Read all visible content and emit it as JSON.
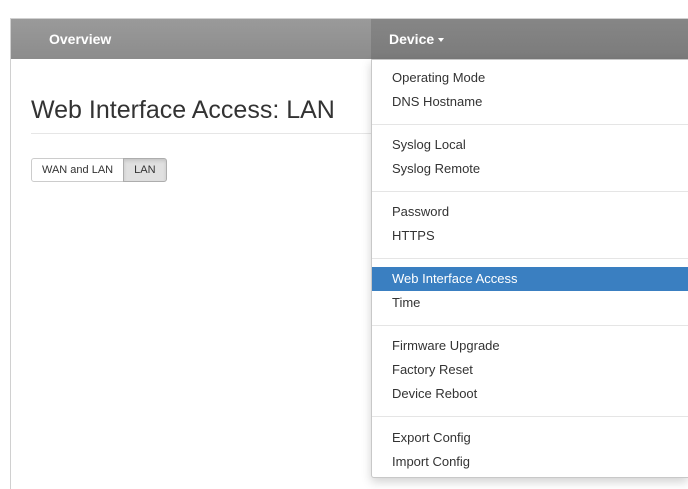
{
  "navbar": {
    "overview_label": "Overview",
    "device_label": "Device"
  },
  "page": {
    "title": "Web Interface Access: LAN",
    "toggle": {
      "options": [
        "WAN and LAN",
        "LAN"
      ],
      "selected": "LAN"
    }
  },
  "device_menu": {
    "items": [
      "Operating Mode",
      "DNS Hostname",
      "Syslog Local",
      "Syslog Remote",
      "Password",
      "HTTPS",
      "Web Interface Access",
      "Time",
      "Firmware Upgrade",
      "Factory Reset",
      "Device Reboot",
      "Export Config",
      "Import Config"
    ],
    "active_item": "Web Interface Access",
    "accent_color": "#3a7fc1"
  }
}
